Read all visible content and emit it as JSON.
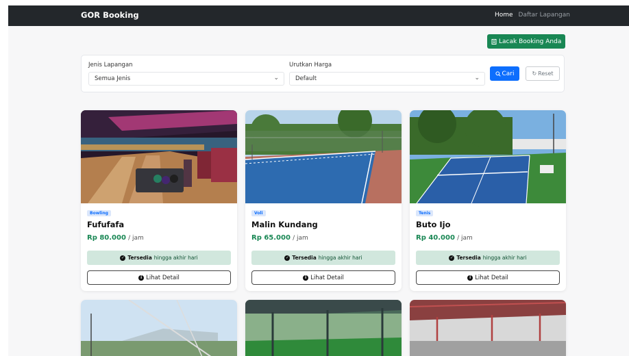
{
  "navbar": {
    "brand": "GOR Booking",
    "links": [
      "Home",
      "Daftar Lapangan"
    ]
  },
  "track_button": "Lacak Booking Anda",
  "filter": {
    "type_label": "Jenis Lapangan",
    "type_value": "Semua Jenis",
    "sort_label": "Urutkan Harga",
    "sort_value": "Default",
    "search_label": "Cari",
    "reset_label": "Reset"
  },
  "cards": [
    {
      "category": "Bowling",
      "name": "Fufufafa",
      "price": "Rp 80.000",
      "unit": "/ jam",
      "status": "Tersedia",
      "status_suffix": "hingga akhir hari",
      "detail": "Lihat Detail"
    },
    {
      "category": "Voli",
      "name": "Malin Kundang",
      "price": "Rp 65.000",
      "unit": "/ jam",
      "status": "Tersedia",
      "status_suffix": "hingga akhir hari",
      "detail": "Lihat Detail"
    },
    {
      "category": "Tenis",
      "name": "Buto Ijo",
      "price": "Rp 40.000",
      "unit": "/ jam",
      "status": "Tersedia",
      "status_suffix": "hingga akhir hari",
      "detail": "Lihat Detail"
    }
  ],
  "colors": {
    "navbar": "#23272b",
    "primary": "#0d6efd",
    "success": "#198754",
    "available_bg": "#d1e7dd"
  },
  "icons": [
    "journal-icon",
    "search-icon",
    "reset-icon",
    "check-circle-icon",
    "info-circle-icon",
    "chevron-down-icon"
  ]
}
